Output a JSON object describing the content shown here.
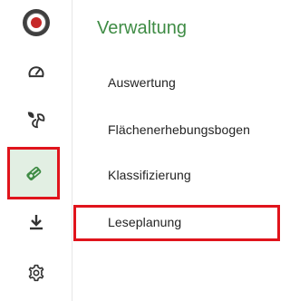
{
  "sidebar": {
    "items": [
      {
        "icon": "logo-seal-icon"
      },
      {
        "icon": "gauge-icon"
      },
      {
        "icon": "leaf-sprout-icon"
      },
      {
        "icon": "field-tag-icon",
        "selected": true
      },
      {
        "icon": "download-icon"
      },
      {
        "icon": "gear-icon"
      }
    ]
  },
  "panel": {
    "title": "Verwaltung",
    "items": [
      {
        "label": "Auswertung"
      },
      {
        "label": "Flächenerhebungsbogen"
      },
      {
        "label": "Klassifizierung"
      },
      {
        "label": "Leseplanung",
        "highlighted": true
      }
    ]
  },
  "colors": {
    "accent": "#3f8c45",
    "selected_bg": "#e2efe3",
    "highlight_border": "#e0141c"
  }
}
